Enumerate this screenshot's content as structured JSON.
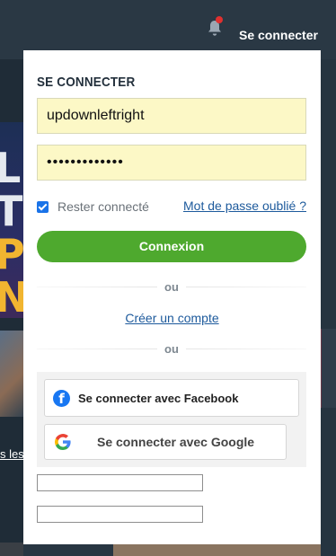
{
  "header": {
    "signin_label": "Se connecter",
    "icon": "bell-icon",
    "notification_dot_color": "#e0302f"
  },
  "background": {
    "banner_letters": [
      "LE",
      "TO",
      "PR",
      "NO"
    ],
    "underlined_text": "s les"
  },
  "login_popup": {
    "title": "SE CONNECTER",
    "username_value": "updownleftright",
    "password_value": "•••••••••••••",
    "remember_label": "Rester connecté",
    "remember_checked": true,
    "forgot_link": "Mot de passe oublié ?",
    "login_button": "Connexion",
    "separator_1": "ou",
    "create_account_link": "Créer un compte",
    "separator_2": "ou",
    "facebook_button": "Se connecter avec Facebook",
    "google_button": "Se connecter avec Google",
    "colors": {
      "login_button": "#4ea92e",
      "link": "#1d5a9c",
      "autofill_field": "#fcf8c6",
      "facebook": "#1877f2"
    }
  }
}
